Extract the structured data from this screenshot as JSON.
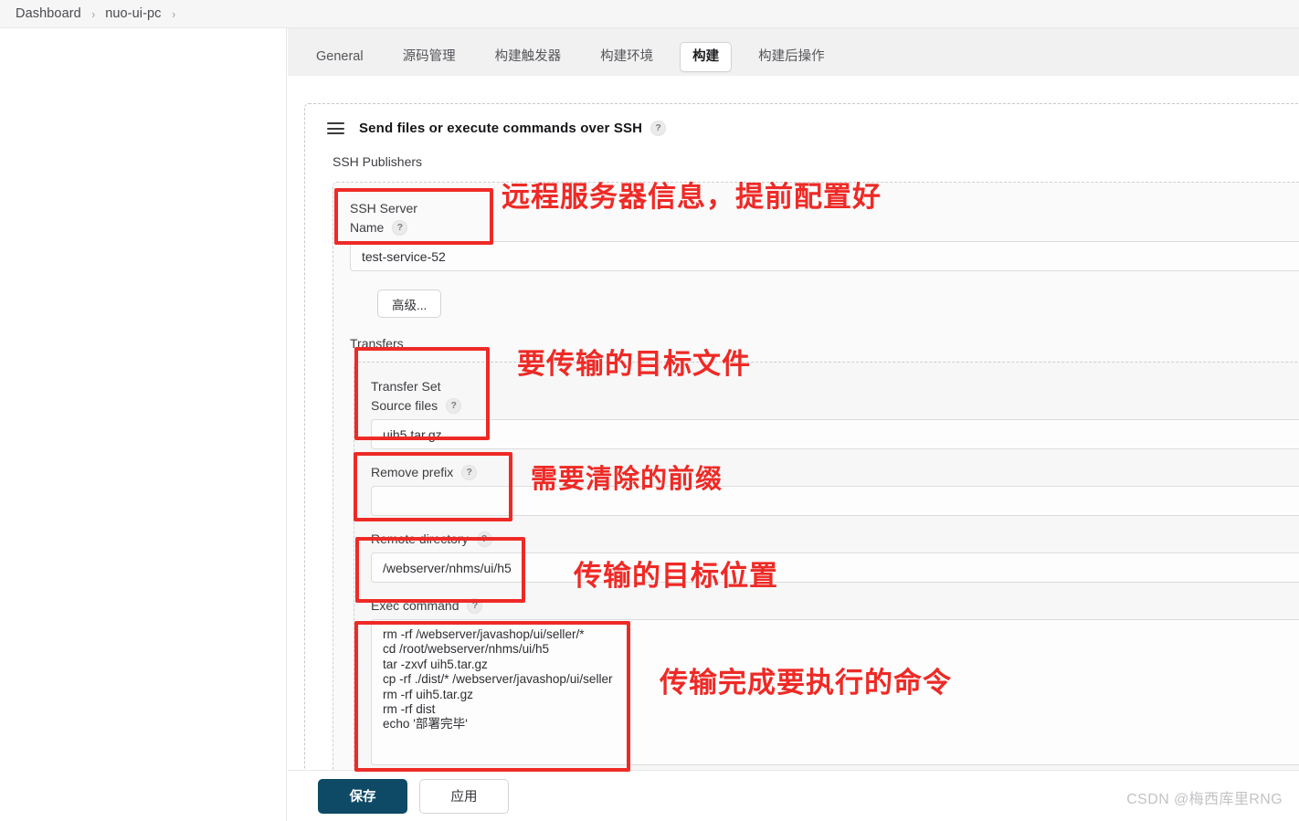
{
  "breadcrumb": {
    "items": [
      {
        "label": "Dashboard"
      },
      {
        "label": "nuo-ui-pc"
      }
    ],
    "separator": "›"
  },
  "tabs": [
    {
      "label": "General",
      "active": false
    },
    {
      "label": "源码管理",
      "active": false
    },
    {
      "label": "构建触发器",
      "active": false
    },
    {
      "label": "构建环境",
      "active": false
    },
    {
      "label": "构建",
      "active": true
    },
    {
      "label": "构建后操作",
      "active": false
    }
  ],
  "builder": {
    "title": "Send files or execute commands over SSH",
    "help": "?",
    "publishers_label": "SSH Publishers",
    "ssh_server": {
      "legend": "SSH Server",
      "name_label": "Name",
      "name_help": "?",
      "name_value": "test-service-52",
      "advanced_button": "高级..."
    },
    "transfers_label": "Transfers",
    "transfer_set": {
      "legend": "Transfer Set",
      "source_files_label": "Source files",
      "source_files_help": "?",
      "source_files_value": "uih5.tar.gz",
      "remove_prefix_label": "Remove prefix",
      "remove_prefix_help": "?",
      "remove_prefix_value": "",
      "remote_directory_label": "Remote directory",
      "remote_directory_help": "?",
      "remote_directory_value": "/webserver/nhms/ui/h5",
      "exec_command_label": "Exec command",
      "exec_command_help": "?",
      "exec_command_value": "rm -rf /webserver/javashop/ui/seller/*\ncd /root/webserver/nhms/ui/h5\ntar -zxvf uih5.tar.gz\ncp -rf ./dist/* /webserver/javashop/ui/seller\nrm -rf uih5.tar.gz\nrm -rf dist\necho '部署完毕'"
    }
  },
  "actions": {
    "save_label": "保存",
    "apply_label": "应用"
  },
  "annotations": [
    {
      "text": "远程服务器信息，提前配置好"
    },
    {
      "text": "要传输的目标文件"
    },
    {
      "text": "需要清除的前缀"
    },
    {
      "text": "传输的目标位置"
    },
    {
      "text": "传输完成要执行的命令"
    }
  ],
  "watermark": "CSDN @梅西库里RNG",
  "colors": {
    "annotation_red": "#ee2a26",
    "save_navy": "#0e4a66",
    "page_bg": "#ffffff",
    "tabbar_bg": "#f1f1f1"
  }
}
